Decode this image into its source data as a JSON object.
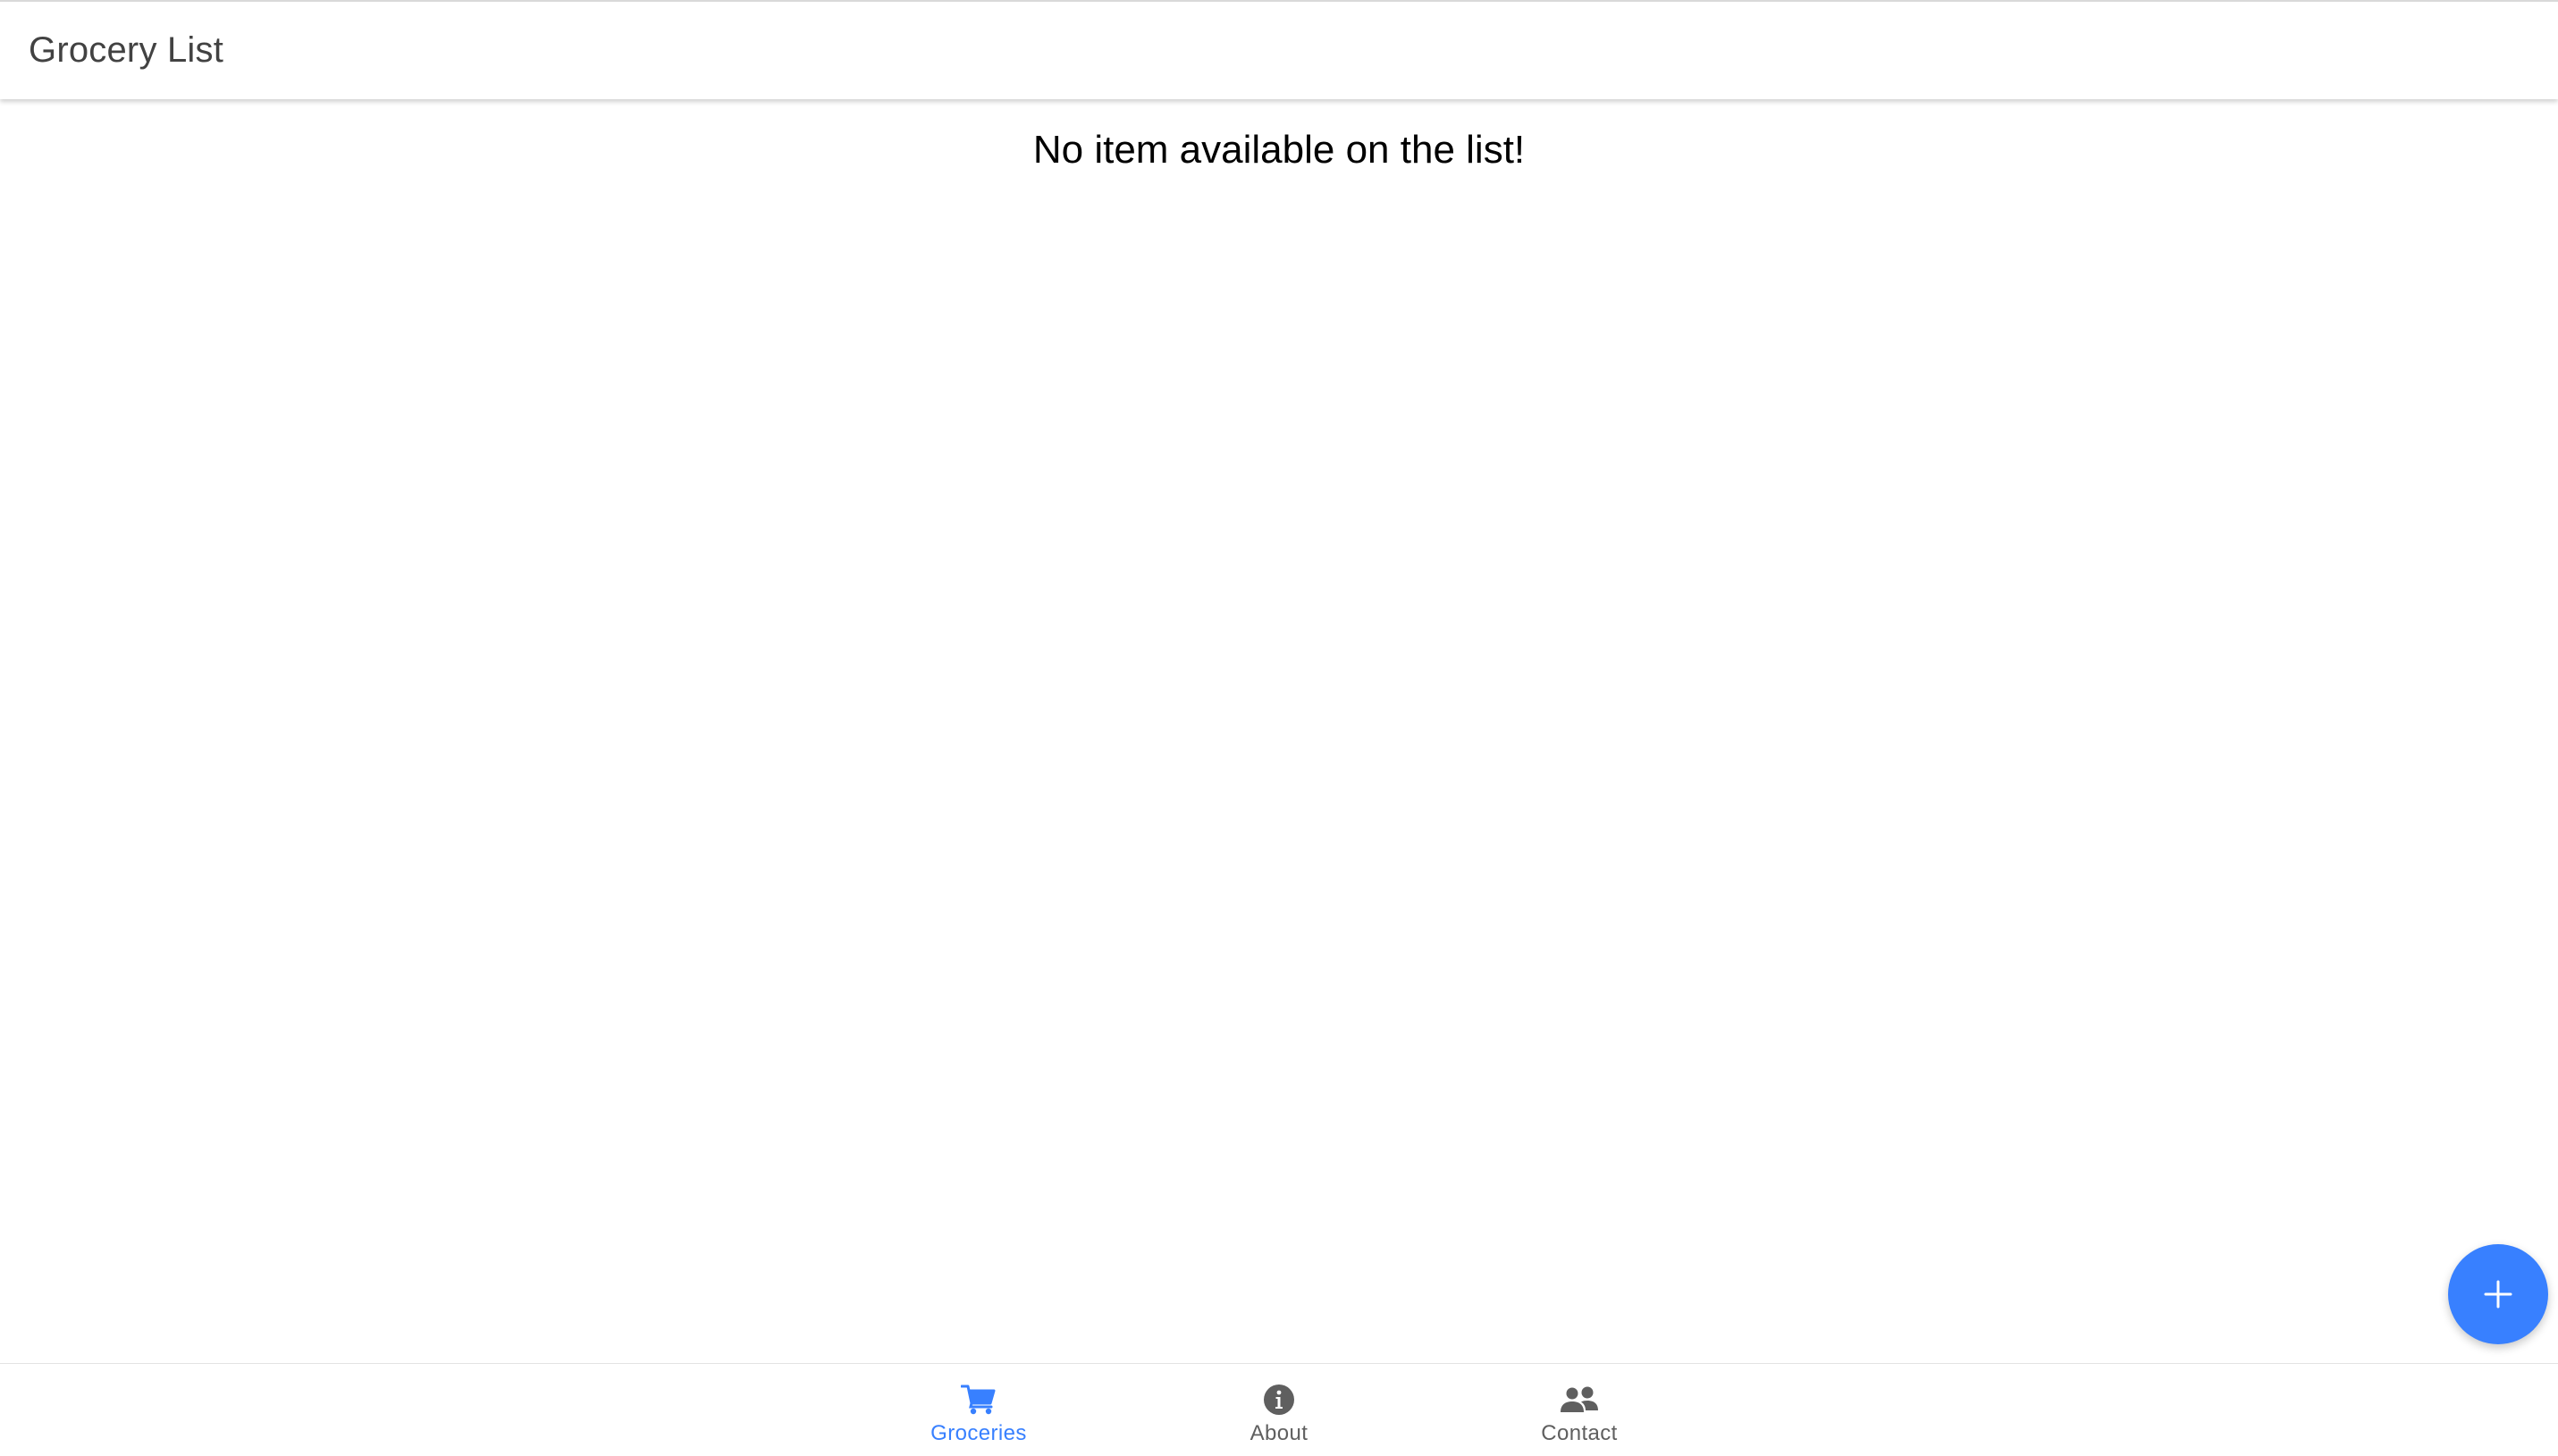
{
  "header": {
    "title": "Grocery List"
  },
  "main": {
    "empty_message": "No item available on the list!"
  },
  "fab": {
    "icon": "add-icon",
    "color": "#3880ff"
  },
  "tabs": [
    {
      "label": "Groceries",
      "icon": "cart-icon",
      "selected": true
    },
    {
      "label": "About",
      "icon": "info-icon",
      "selected": false
    },
    {
      "label": "Contact",
      "icon": "people-icon",
      "selected": false
    }
  ],
  "colors": {
    "accent": "#3880ff",
    "tab_inactive": "#5f5f5f",
    "title": "#424242"
  }
}
